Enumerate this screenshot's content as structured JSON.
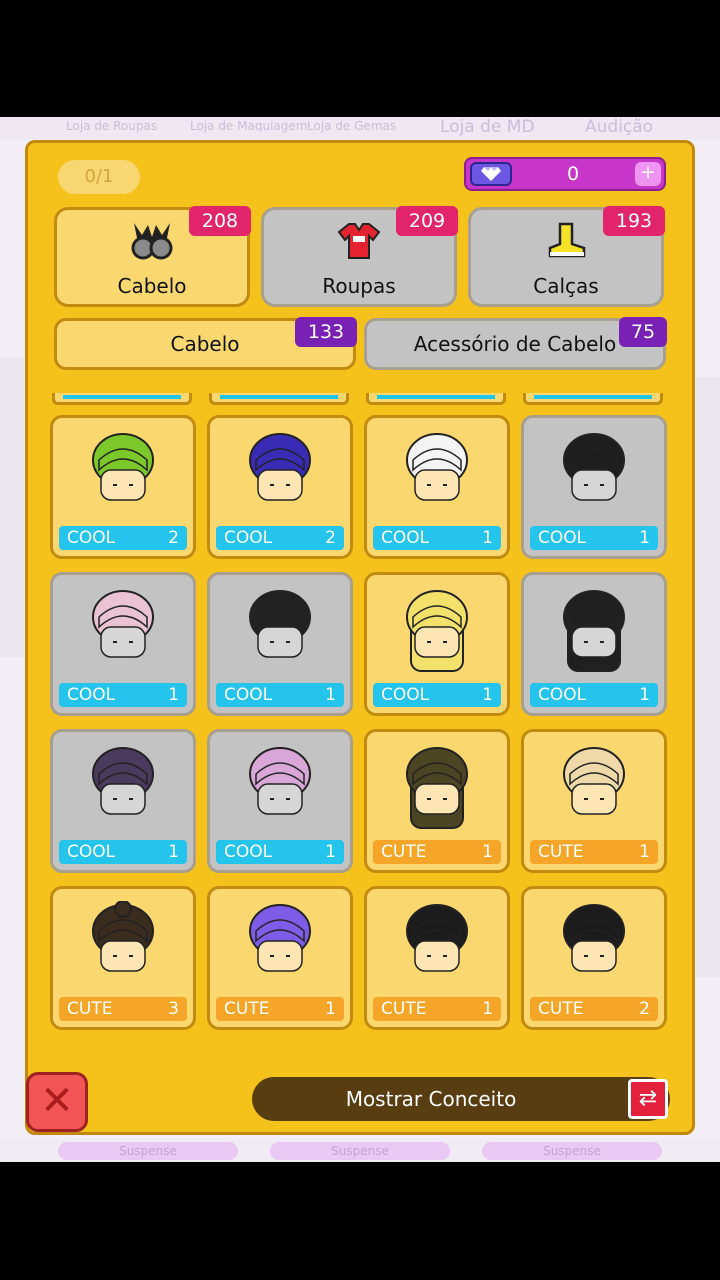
{
  "background": {
    "shop_tabs": [
      "Loja de Roupas",
      "Loja de Maquiagem",
      "Loja de Gemas",
      "Loja de MD",
      "Audição"
    ],
    "bottom_pills": [
      "Suspense",
      "Suspense",
      "Suspense"
    ]
  },
  "header": {
    "counter": "0/1",
    "gems": {
      "value": "0",
      "icon": "gem-icon",
      "plus": "+"
    }
  },
  "categories": [
    {
      "label": "Cabelo",
      "count": "208",
      "icon": "hair-icon",
      "active": true
    },
    {
      "label": "Roupas",
      "count": "209",
      "icon": "shirt-icon",
      "active": false
    },
    {
      "label": "Calças",
      "count": "193",
      "icon": "shoe-icon",
      "active": false
    }
  ],
  "subcategories": [
    {
      "label": "Cabelo",
      "count": "133",
      "active": true
    },
    {
      "label": "Acessório de Cabelo",
      "count": "75",
      "active": false
    }
  ],
  "items": [
    {
      "tag": "COOL",
      "count": "2",
      "owned": true,
      "hair": "#7cc82a"
    },
    {
      "tag": "COOL",
      "count": "2",
      "owned": true,
      "hair": "#3a2bb4"
    },
    {
      "tag": "COOL",
      "count": "1",
      "owned": true,
      "hair": "#f4f4f4"
    },
    {
      "tag": "COOL",
      "count": "1",
      "owned": false,
      "hair": "#1e1e1e"
    },
    {
      "tag": "COOL",
      "count": "1",
      "owned": false,
      "hair": "#e9c3d3"
    },
    {
      "tag": "COOL",
      "count": "1",
      "owned": false,
      "hair": "#222222"
    },
    {
      "tag": "COOL",
      "count": "1",
      "owned": true,
      "hair": "#f2e16a"
    },
    {
      "tag": "COOL",
      "count": "1",
      "owned": false,
      "hair": "#202020"
    },
    {
      "tag": "COOL",
      "count": "1",
      "owned": false,
      "hair": "#4a3a5e"
    },
    {
      "tag": "COOL",
      "count": "1",
      "owned": false,
      "hair": "#d8a7d8"
    },
    {
      "tag": "CUTE",
      "count": "1",
      "owned": true,
      "hair": "#4b4523"
    },
    {
      "tag": "CUTE",
      "count": "1",
      "owned": true,
      "hair": "#efd9a8"
    },
    {
      "tag": "CUTE",
      "count": "3",
      "owned": true,
      "hair": "#3a2c1e"
    },
    {
      "tag": "CUTE",
      "count": "1",
      "owned": true,
      "hair": "#7e5ce8"
    },
    {
      "tag": "CUTE",
      "count": "1",
      "owned": true,
      "hair": "#1c1c1c"
    },
    {
      "tag": "CUTE",
      "count": "2",
      "owned": true,
      "hair": "#1c1c1c"
    }
  ],
  "footer": {
    "close": "✕",
    "concept_label": "Mostrar Conceito",
    "concept_icon": "⇄"
  }
}
